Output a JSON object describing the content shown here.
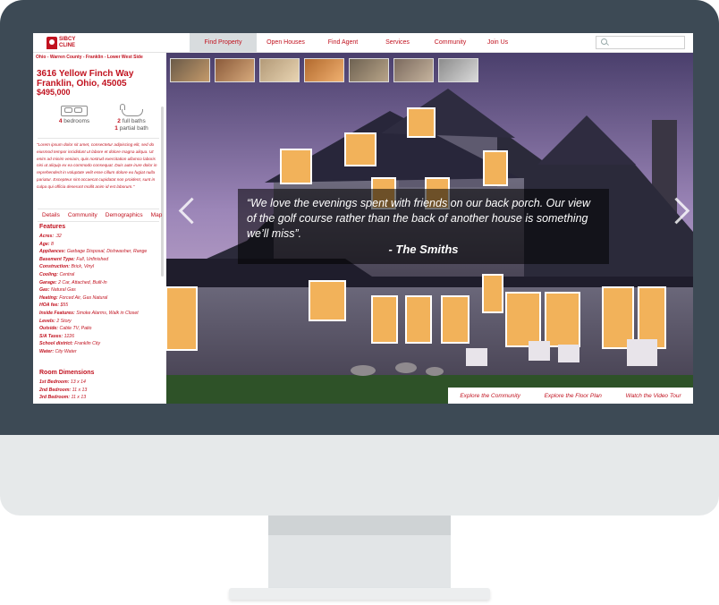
{
  "brand": {
    "logo_text": "SIBCY CLINE",
    "accent": "#c1121f"
  },
  "nav": {
    "items": [
      {
        "label": "Find Property",
        "active": true
      },
      {
        "label": "Open Houses"
      },
      {
        "label": "Find Agent"
      },
      {
        "label": "Services"
      },
      {
        "label": "Community"
      },
      {
        "label": "Join Us"
      }
    ]
  },
  "search": {
    "placeholder": ""
  },
  "listing": {
    "breadcrumb": "Ohio - Warren County - Franklin - Lower West Side",
    "street": "3616 Yellow Finch Way",
    "city": "Franklin, Ohio, 45005",
    "price": "$495,000",
    "beds_count": "4",
    "beds_label": "bedrooms",
    "full_baths_count": "2",
    "full_baths_label": "full baths",
    "partial_baths_count": "1",
    "partial_baths_label": "partial bath",
    "description": "\"Lorem ipsum dolor sit amet, consectetur adipiscing elit, sed do eiusmod tempor incididunt ut labore et dolore magna aliqua. Ut enim ad minim veniam, quis nostrud exercitation ullamco laboris nisi ut aliquip ex ea commodo consequat. Duis aute irure dolor in reprehenderit in voluptate velit esse cillum dolore eu fugiat nulla pariatur. Excepteur sint occaecat cupidatat non proident, sunt in culpa qui officia deserunt mollit anim id est laborum.\""
  },
  "tabs": [
    "Details",
    "Community",
    "Demographics",
    "Map"
  ],
  "features": {
    "heading": "Features",
    "items": [
      {
        "label": "Acres:",
        "value": ".32"
      },
      {
        "label": "Age:",
        "value": "8"
      },
      {
        "label": "Appliances:",
        "value": "Garbage Disposal, Dishwasher, Range"
      },
      {
        "label": "Basement Type:",
        "value": "Full, Unfinished"
      },
      {
        "label": "Construction:",
        "value": "Brick, Vinyl"
      },
      {
        "label": "Cooling:",
        "value": "Central"
      },
      {
        "label": "Garage:",
        "value": "2 Car, Attached, Built-In"
      },
      {
        "label": "Gas:",
        "value": "Natural Gas"
      },
      {
        "label": "Heating:",
        "value": "Forced Air, Gas Natural"
      },
      {
        "label": "HOA fee:",
        "value": "$55"
      },
      {
        "label": "Inside Features:",
        "value": "Smoke Alarms, Walk in Closet"
      },
      {
        "label": "Levels:",
        "value": "2 Story"
      },
      {
        "label": "Outside:",
        "value": "Cable TV, Patio"
      },
      {
        "label": "S/A Taxes:",
        "value": "1226"
      },
      {
        "label": "School district:",
        "value": "Franklin City"
      },
      {
        "label": "Water:",
        "value": "City Water"
      }
    ]
  },
  "rooms": {
    "heading": "Room Dimensions",
    "items": [
      {
        "label": "1st Bedroom:",
        "value": "13 x 14"
      },
      {
        "label": "2nd Bedroom:",
        "value": "11 x 13"
      },
      {
        "label": "3rd Bedroom:",
        "value": "11 x 13"
      }
    ]
  },
  "hero": {
    "quote": "“We love the evenings spent with friends on our back porch. Our view of the golf course rather than the back of another house is something we’ll miss”.",
    "attribution": "- The Smiths",
    "links": [
      "Explore the Community",
      "Explore the Floor Plan",
      "Watch the Video Tour"
    ]
  }
}
